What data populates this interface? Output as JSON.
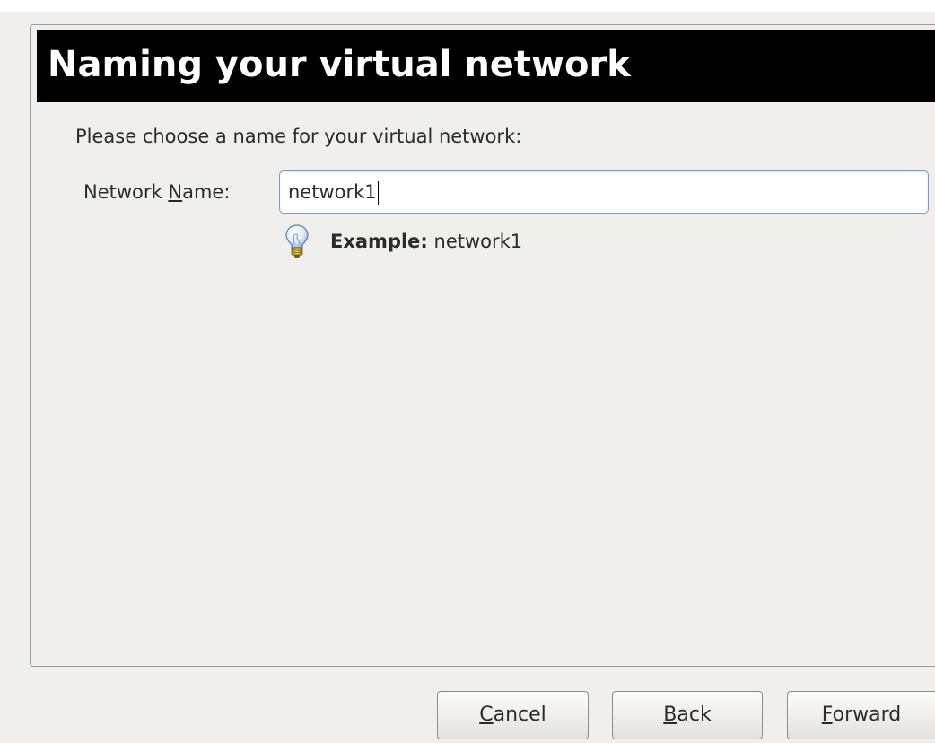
{
  "header": {
    "title": "Naming your virtual network"
  },
  "instruction": "Please choose a name for your virtual network:",
  "network_name": {
    "label_prefix": "Network ",
    "label_mnemonic": "N",
    "label_suffix": "ame:",
    "value": "network1"
  },
  "hint": {
    "icon": "lightbulb-icon",
    "key": "Example:",
    "value": " network1"
  },
  "buttons": {
    "cancel": {
      "mnemonic": "C",
      "rest": "ancel"
    },
    "back": {
      "mnemonic": "B",
      "rest": "ack"
    },
    "forward": {
      "mnemonic": "F",
      "rest": "orward"
    }
  },
  "colors": {
    "header_background": "#000000",
    "header_text": "#ffffff",
    "window_background": "#f1efed",
    "input_focus_border": "#7a9cc8"
  }
}
